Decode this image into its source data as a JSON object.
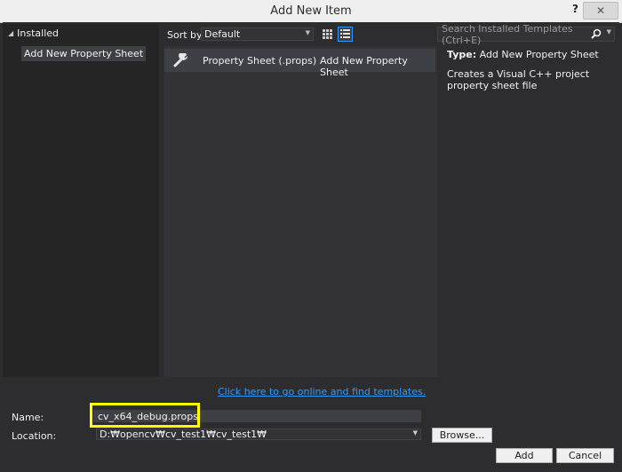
{
  "window": {
    "title": "Add New Item",
    "help_label": "?",
    "close_label": "✕"
  },
  "tree": {
    "root_label": "Installed",
    "child_label": "Add New Property Sheet"
  },
  "toolbar": {
    "sort_label": "Sort by:",
    "sort_value": "Default",
    "search_placeholder": "Search Installed Templates (Ctrl+E)"
  },
  "templates": [
    {
      "name": "Property Sheet (.props)",
      "description": "Add New Property Sheet",
      "icon": "wrench-icon",
      "selected": true
    }
  ],
  "detail": {
    "type_key": "Type:",
    "type_value": "Add New Property Sheet",
    "description": "Creates a Visual C++ project property sheet file"
  },
  "online_link": "Click here to go online and find templates.",
  "form": {
    "name_label": "Name:",
    "name_value": "cv_x64_debug.props",
    "location_label": "Location:",
    "location_value": "D:₩opencv₩cv_test1₩cv_test1₩",
    "browse_label": "Browse...",
    "add_label": "Add",
    "cancel_label": "Cancel"
  },
  "colors": {
    "background": "#2d2d30",
    "panel": "#252526",
    "selection": "#3f3f46",
    "link": "#3399ff",
    "highlight": "#ffff00"
  }
}
